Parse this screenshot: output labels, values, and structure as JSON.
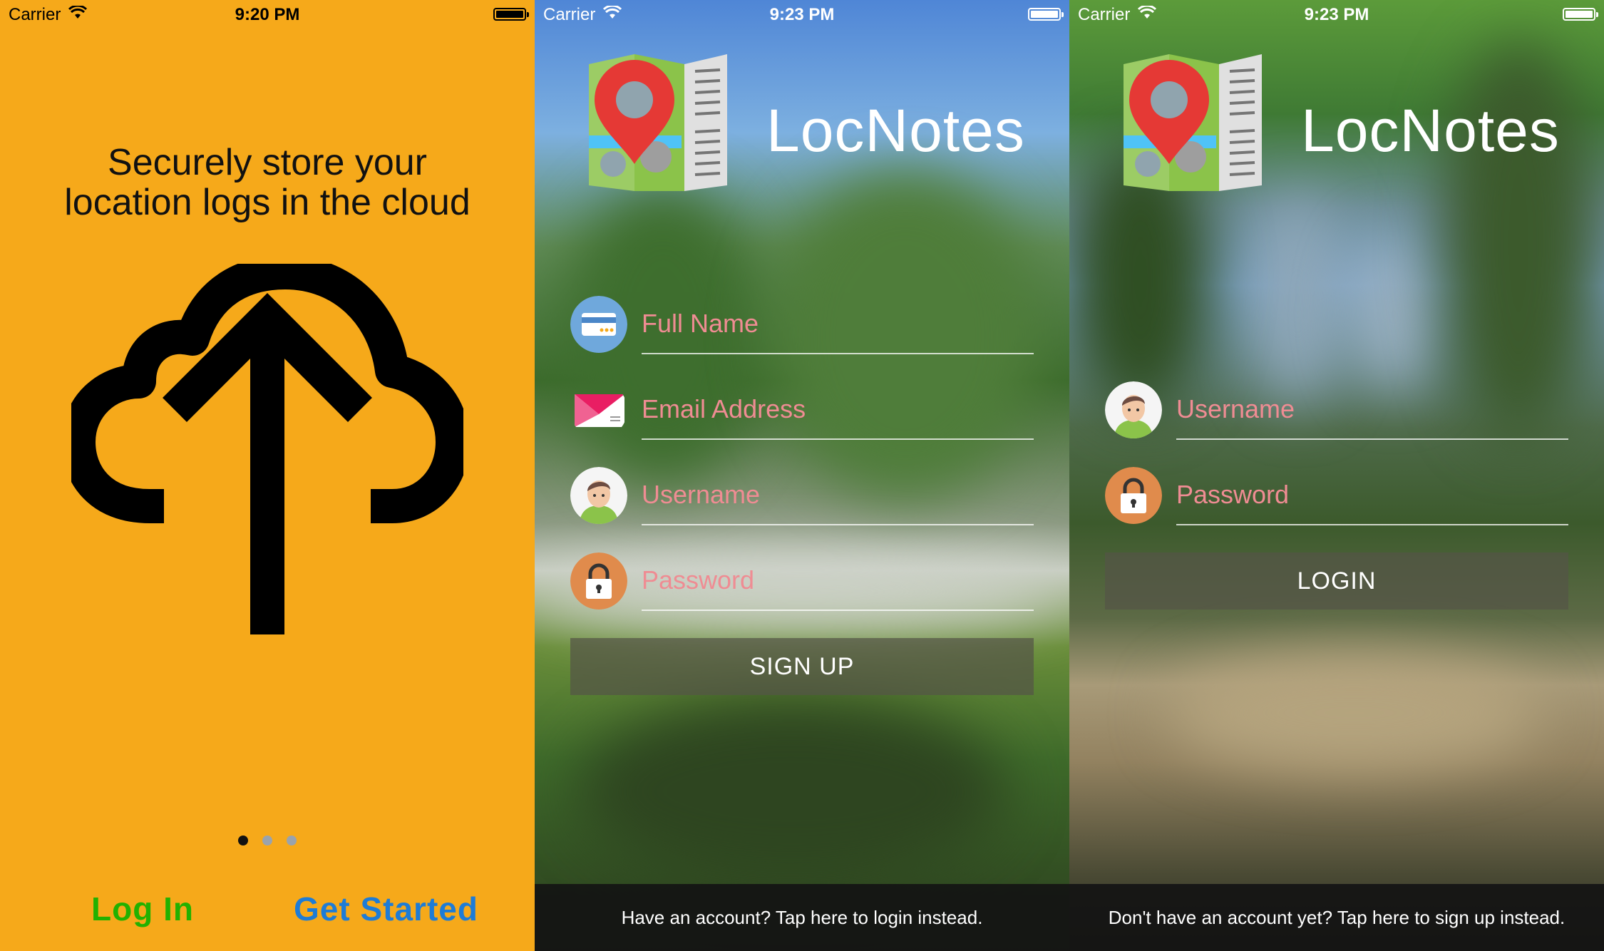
{
  "onboarding": {
    "status": {
      "carrier": "Carrier",
      "time": "9:20 PM"
    },
    "headline_line1": "Securely store your",
    "headline_line2": "location logs in the cloud",
    "page_count": 3,
    "active_page": 1,
    "login_label": "Log In",
    "get_started_label": "Get Started",
    "colors": {
      "background": "#f6a91a",
      "login": "#22b100",
      "get_started": "#1e7cd6"
    }
  },
  "signup": {
    "status": {
      "carrier": "Carrier",
      "time": "9:23 PM"
    },
    "app_name": "LocNotes",
    "fields": [
      {
        "icon": "id-card-icon",
        "placeholder": "Full Name"
      },
      {
        "icon": "envelope-icon",
        "placeholder": "Email Address"
      },
      {
        "icon": "user-avatar-icon",
        "placeholder": "Username"
      },
      {
        "icon": "padlock-icon",
        "placeholder": "Password"
      }
    ],
    "button_label": "SIGN UP",
    "footer_text": "Have an account? Tap here to login instead."
  },
  "login": {
    "status": {
      "carrier": "Carrier",
      "time": "9:23 PM"
    },
    "app_name": "LocNotes",
    "fields": [
      {
        "icon": "user-avatar-icon",
        "placeholder": "Username"
      },
      {
        "icon": "padlock-icon",
        "placeholder": "Password"
      }
    ],
    "button_label": "LOGIN",
    "footer_text": "Don't have an account yet? Tap here to sign up instead."
  }
}
